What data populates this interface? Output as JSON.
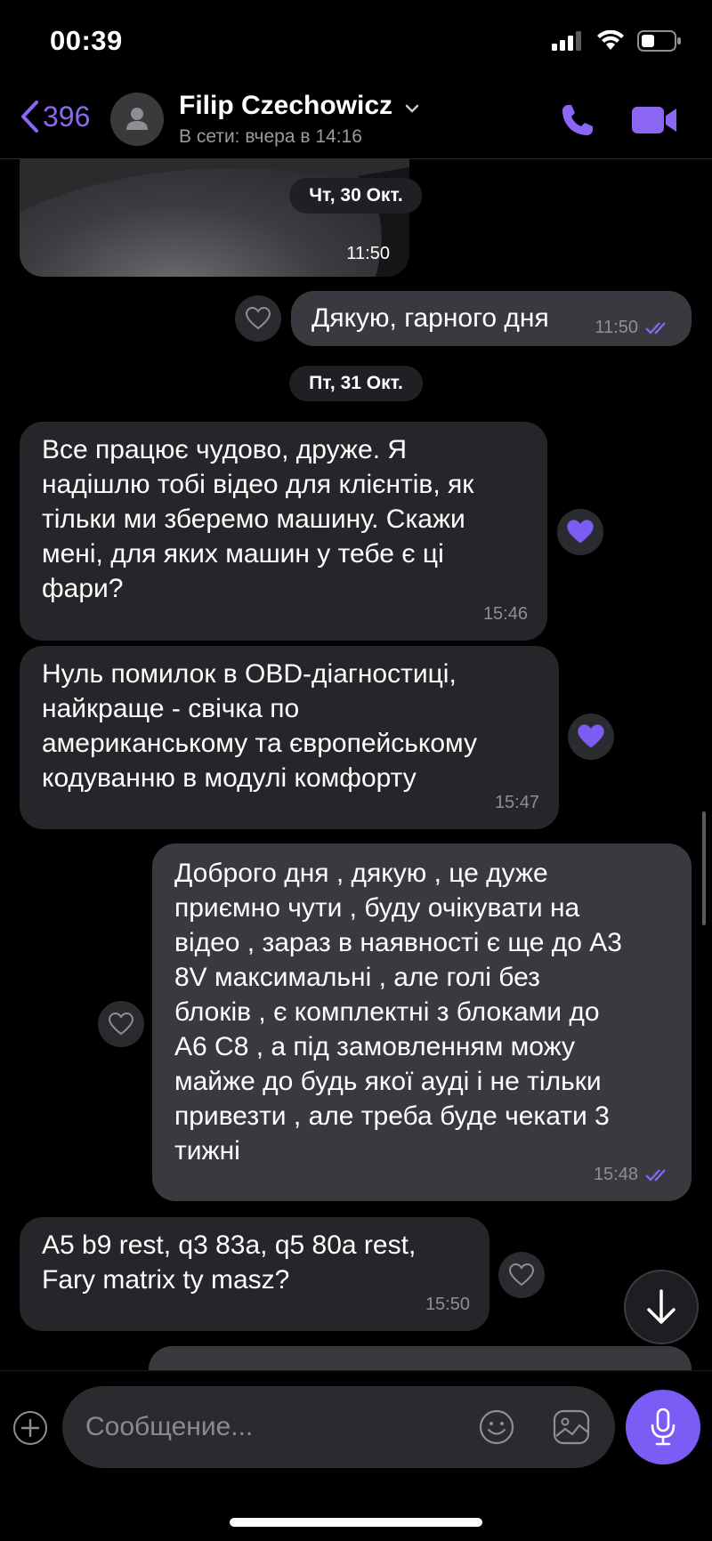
{
  "status_bar": {
    "time": "00:39"
  },
  "header": {
    "back_count": "396",
    "contact_name": "Filip Czechowicz",
    "contact_status": "В сети: вчера в 14:16"
  },
  "media": {
    "time": "11:50"
  },
  "dates": {
    "d1": "Чт, 30 Окт.",
    "d2": "Пт, 31 Окт."
  },
  "messages": [
    {
      "text": "Дякую, гарного дня",
      "time": "11:50"
    },
    {
      "text": "Все працює чудово, друже. Я\nнадішлю тобі відео для клієнтів, як\nтільки ми зберемо машину. Скажи\nмені, для яких машин у тебе є ці\nфари?",
      "time": "15:46"
    },
    {
      "text": "Нуль помилок в OBD-діагностиці,\nнайкраще - свічка по\nамериканському та європейському\nкодуванню в модулі комфорту",
      "time": "15:47"
    },
    {
      "text": "Доброго дня , дякую , це дуже\nприємно чути , буду очікувати на\nвідео , зараз в наявності є ще до А3\n8V максимальні , але голі без\nблоків , є комплектні з блоками до\nА6 С8 , а під замовленням можу\nмайже до будь якої ауді і не тільки\nпривезти , але треба буде чекати 3\nтижні",
      "time": "15:48"
    },
    {
      "text": "A5 b9 rest, q3 83a, q5 80a rest,\nFary matrix ty masz?",
      "time": "15:50"
    }
  ],
  "composer": {
    "placeholder": "Сообщение..."
  },
  "colors": {
    "accent": "#7b5cf5",
    "incoming_bubble": "#252629",
    "outgoing_bubble": "#393a3f"
  }
}
